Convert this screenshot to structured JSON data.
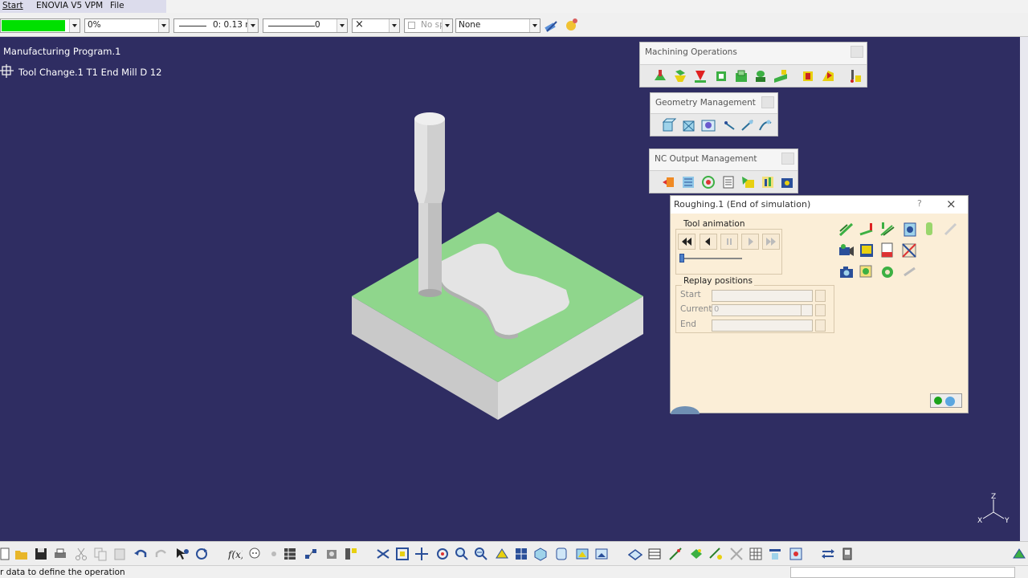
{
  "menubar": {
    "items": [
      "Start",
      "ENOVIA V5 VPM",
      "File"
    ]
  },
  "toolbar": {
    "percent": "0%",
    "line_weight": "0: 0.13 r",
    "line_type": "0",
    "point_symbol": "×",
    "no_spec": "No sp",
    "layer": "None"
  },
  "tree": {
    "program": "Manufacturing Program.1",
    "tool_change": "Tool Change.1  T1 End Mill D 12"
  },
  "toolbars": {
    "machining": {
      "title": "Machining Operations"
    },
    "geometry": {
      "title": "Geometry Management"
    },
    "nc_output": {
      "title": "NC Output Management"
    }
  },
  "dialog": {
    "title": "Roughing.1 (End of simulation)",
    "help": "?",
    "close": "×",
    "tool_animation": "Tool animation",
    "replay_positions": "Replay positions",
    "start_label": "Start",
    "current_label": "Current",
    "current_value": "0",
    "end_label": "End",
    "progress": 0
  },
  "compass": {
    "z": "Z",
    "x": "X",
    "y": "Y"
  },
  "status": {
    "text": "r data to define the operation"
  },
  "colors": {
    "background": "#2f2d62",
    "part_top": "#8fd68c",
    "part_side": "#c8c8c8",
    "dialog_bg": "#fbeed7"
  }
}
